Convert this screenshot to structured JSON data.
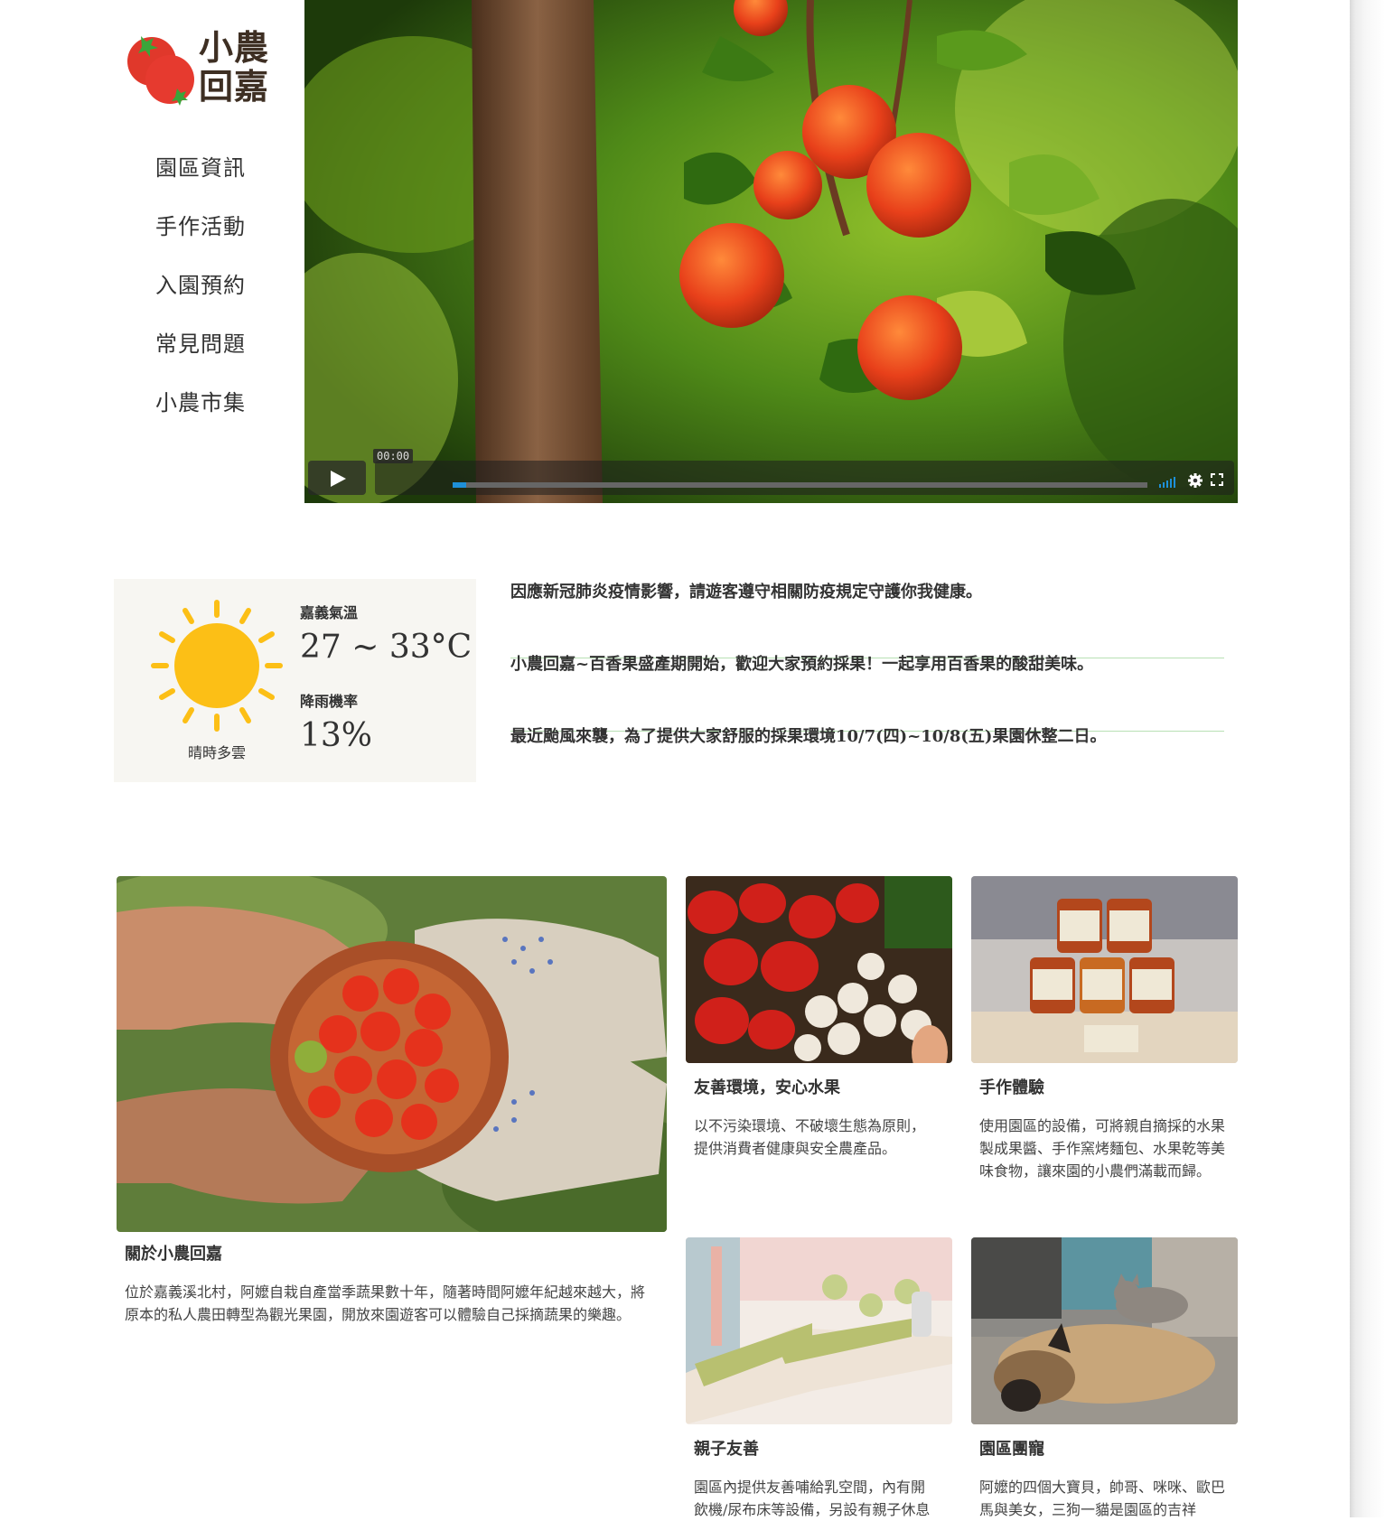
{
  "brand": {
    "logo_line1": "小農",
    "logo_line2": "回嘉",
    "colors": {
      "tomato": "#e0382b",
      "leaf": "#3aa53a",
      "text": "#3e2f23"
    }
  },
  "nav": {
    "items": [
      {
        "label": "園區資訊"
      },
      {
        "label": "手作活動"
      },
      {
        "label": "入園預約"
      },
      {
        "label": "常見問題"
      },
      {
        "label": "小農市集"
      }
    ]
  },
  "video": {
    "time": "00:00",
    "progress": 0.02,
    "controls": [
      "play-icon",
      "volume-icon",
      "gear-icon",
      "fullscreen-icon"
    ]
  },
  "weather": {
    "temp_label": "嘉義氣溫",
    "temp": "27 ~ 33°C",
    "rain_label": "降雨機率",
    "rain": "13%",
    "condition": "晴時多雲",
    "icon": "sun-icon",
    "sun_color": "#fcbf16"
  },
  "news": [
    {
      "text": "因應新冠肺炎疫情影響，請遊客遵守相關防疫規定守護你我健康。"
    },
    {
      "text": "小農回嘉~百香果盛產期開始，歡迎大家預約採果！一起享用百香果的酸甜美味。"
    },
    {
      "text": "最近颱風來襲，為了提供大家舒服的採果環境10/7(四)~10/8(五)果園休整二日。"
    }
  ],
  "cards": {
    "about": {
      "title": "關於小農回嘉",
      "text": "位於嘉義溪北村，阿嬤自栽自產當季蔬果數十年，隨著時間阿嬤年紀越來越大，將原本的私人農田轉型為觀光果園，開放來園遊客可以體驗自己採摘蔬果的樂趣。"
    },
    "eco": {
      "title": "友善環境，安心水果",
      "text": "以不污染環境、不破壞生態為原則，提供消費者健康與安全農產品。"
    },
    "diy": {
      "title": "手作體驗",
      "text": "使用園區的設備，可將親自摘採的水果製成果醬、手作窯烤麵包、水果乾等美味食物，讓來園的小農們滿載而歸。"
    },
    "family": {
      "title": "親子友善",
      "text": "園區內提供友善哺給乳空間，內有開飲機/尿布床等設備，另設有親子休息"
    },
    "pets": {
      "title": "園區團寵",
      "text": "阿嬤的四個大寶貝，帥哥、咪咪、歐巴馬與美女，三狗一貓是園區的吉祥"
    }
  }
}
